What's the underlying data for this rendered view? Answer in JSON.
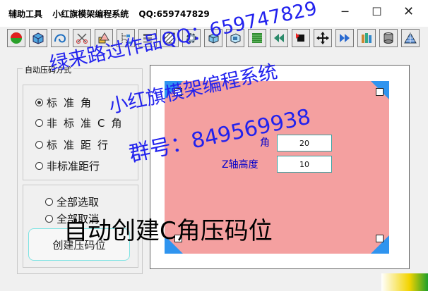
{
  "window": {
    "title_parts": [
      "辅助工具",
      "小红旗模架编程系统",
      "QQ:659747829"
    ],
    "minimize_icon": "─",
    "maximize_icon": "☐",
    "close_icon": "✕"
  },
  "toolbar": {
    "icons": [
      "traffic-light-icon",
      "box-icon",
      "curve-icon",
      "scissors-icon",
      "shapes-icon",
      "tree-icon",
      "stack-icon",
      "hatch-icon",
      "gear-icon",
      "cube-icon",
      "cube-outline-icon",
      "striped-square-icon",
      "rewind-icon",
      "play-square-icon",
      "move-icon",
      "fast-forward-icon",
      "books-icon",
      "cylinder-icon",
      "mesh-icon"
    ]
  },
  "panel": {
    "group_title": "自动压码方式",
    "options_top": [
      {
        "label": "标准角",
        "selected": true
      },
      {
        "label": "非标准C角",
        "selected": false
      },
      {
        "label": "标准距行",
        "selected": false
      },
      {
        "label": "非标准距行",
        "selected": false
      }
    ],
    "options_bottom": [
      {
        "label": "全部选取",
        "selected": false
      },
      {
        "label": "全部取消",
        "selected": false
      }
    ],
    "create_button": "创建压码位"
  },
  "preview": {
    "angle_label": "角",
    "angle_value": "20",
    "z_label": "Z轴高度",
    "z_value": "10",
    "colors": {
      "plate": "#f4a0a0",
      "corner": "#2f94ef"
    }
  },
  "overlay": {
    "watermark_line1": "绿来路过作品QQ：659747829",
    "watermark_line2": "小红旗模架编程系统",
    "watermark_line3": "群号：849569938",
    "caption": "自动创建C角压码位"
  }
}
